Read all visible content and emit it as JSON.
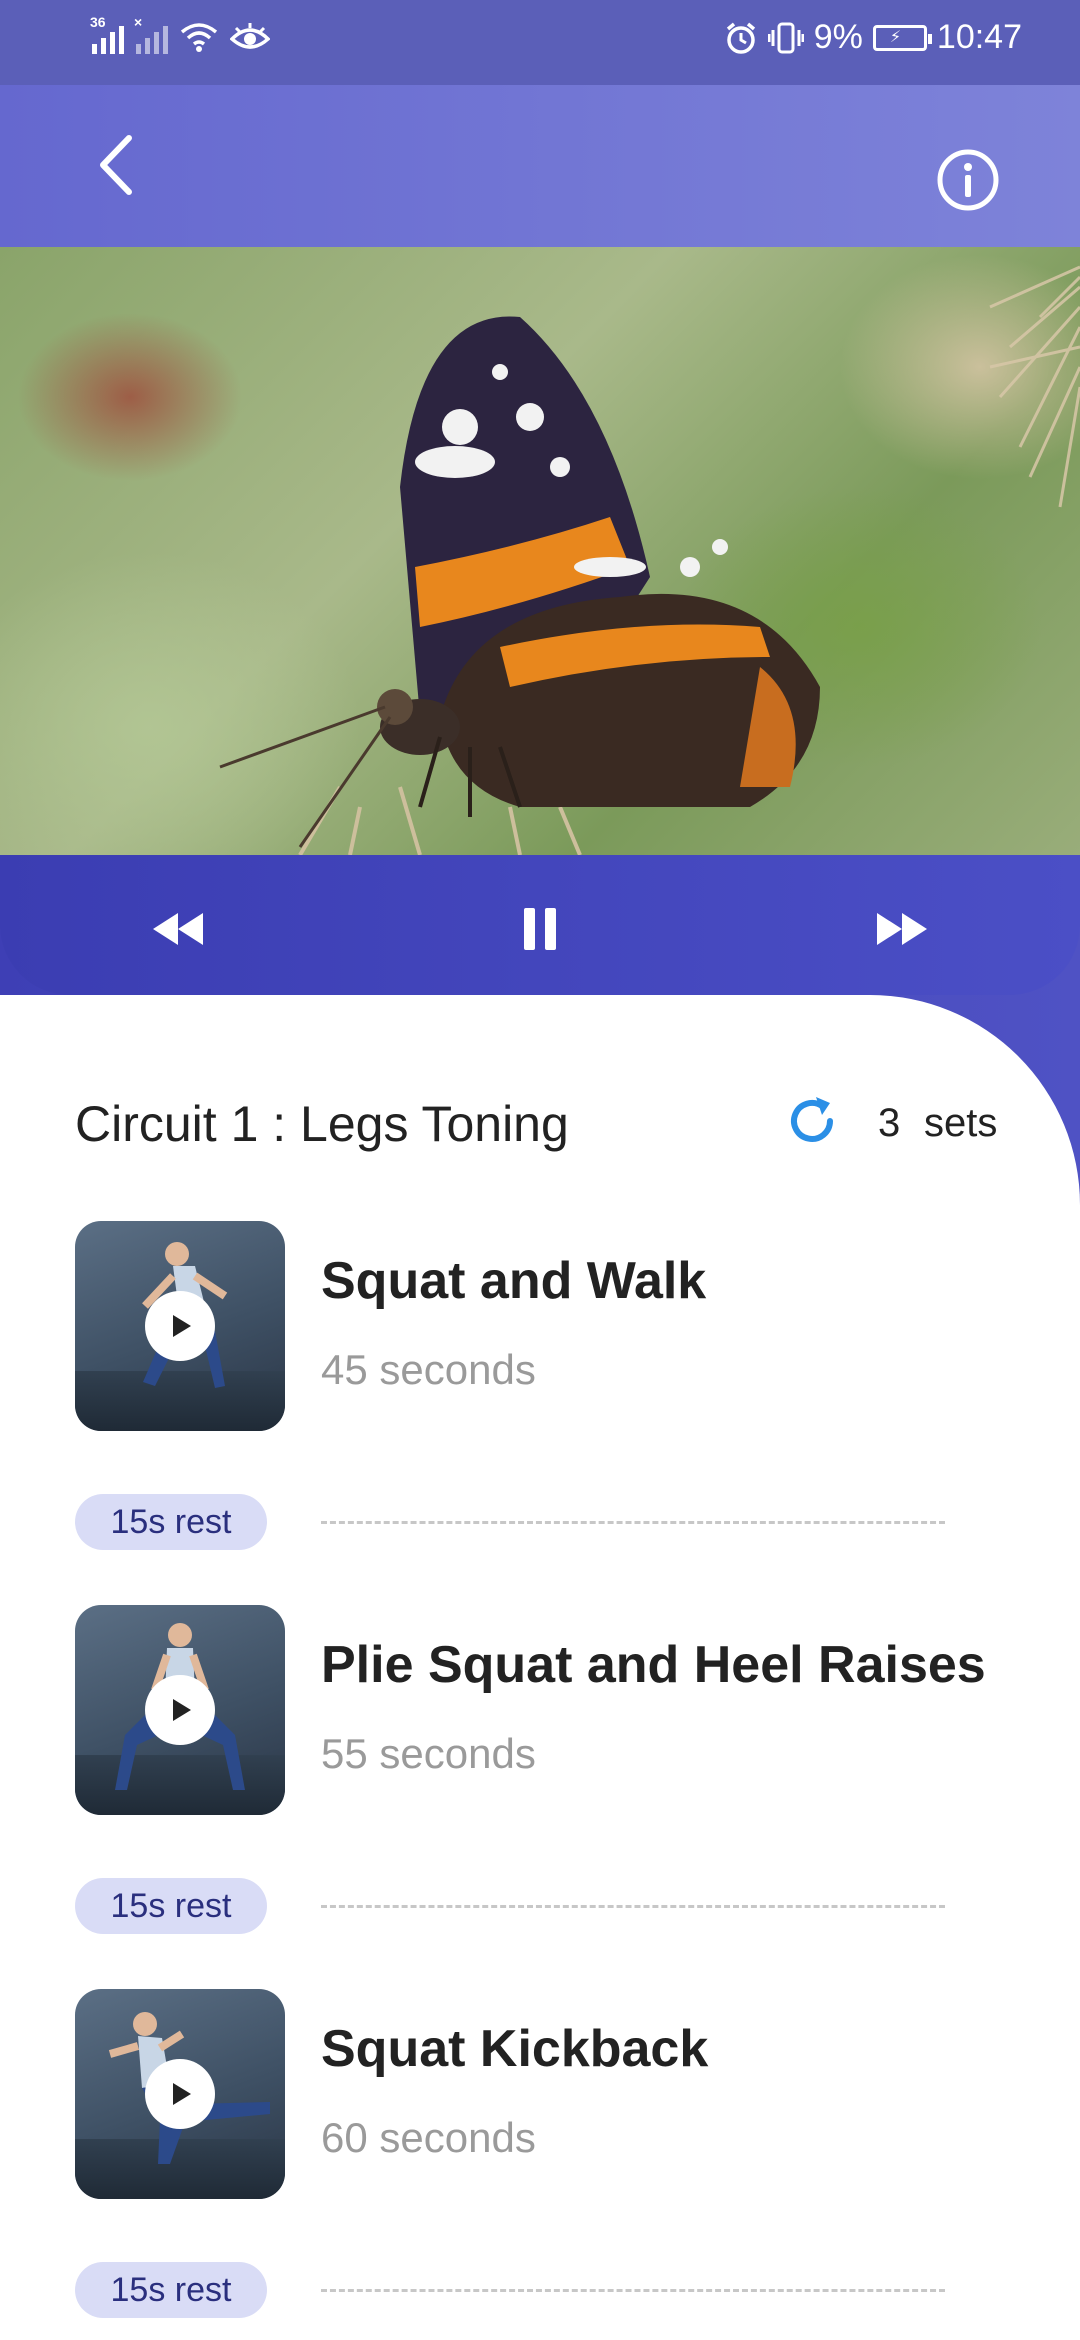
{
  "status_bar": {
    "network_label": "36",
    "battery_percent": "9%",
    "time": "10:47"
  },
  "header": {
    "back_icon": "chevron-left-icon",
    "info_icon": "info-icon"
  },
  "player": {
    "rewind_icon": "rewind-icon",
    "pause_icon": "pause-icon",
    "forward_icon": "fast-forward-icon"
  },
  "circuit": {
    "title": "Circuit 1 : Legs Toning",
    "sets_count": "3",
    "sets_label": "sets"
  },
  "exercises": [
    {
      "name": "Squat and Walk",
      "duration": "45 seconds",
      "rest": "15s rest"
    },
    {
      "name": "Plie Squat and Heel Raises",
      "duration": "55 seconds",
      "rest": "15s rest"
    },
    {
      "name": "Squat Kickback",
      "duration": "60 seconds",
      "rest": "15s rest"
    }
  ],
  "colors": {
    "status_bar": "#5b5fb8",
    "header_start": "#6568cf",
    "header_end": "#7e83d9",
    "controls": "#4447bd",
    "accent_blue": "#2b8fe6",
    "rest_badge_bg": "#d9dcf6",
    "rest_badge_text": "#2a2f7e"
  }
}
